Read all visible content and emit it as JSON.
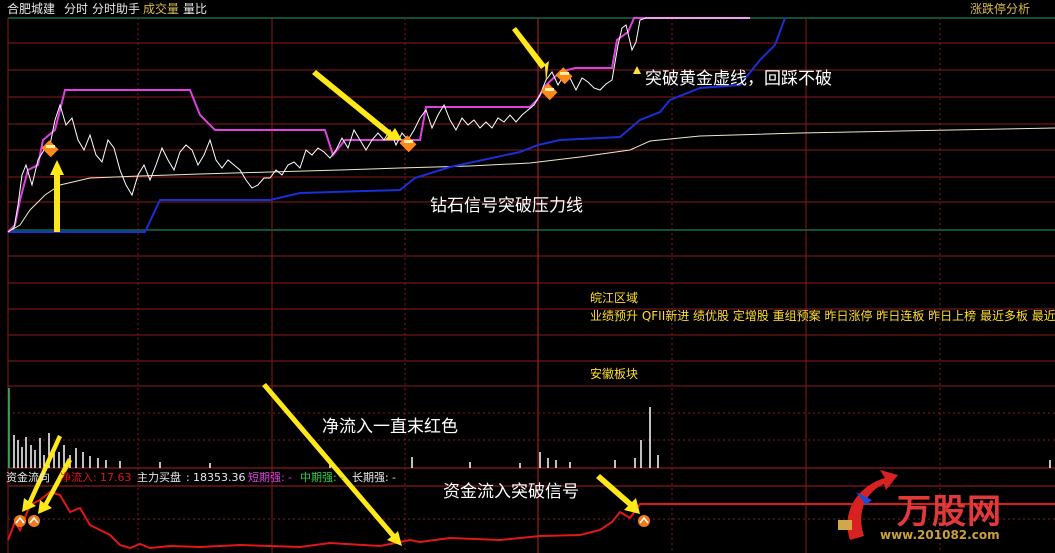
{
  "header": {
    "stock_name": "合肥城建",
    "tab_intraday": "分时",
    "tab_helper": "分时助手",
    "tab_volume": "成交量",
    "tab_ratio": "量比",
    "right_button": "涨跌停分析"
  },
  "annotations": {
    "golden_line": "突破黄金虚线，回踩不破",
    "diamond_signal": "钻石信号突破压力线",
    "net_inflow": "净流入一直末红色",
    "fund_signal": "资金流入突破信号"
  },
  "info_panel": {
    "region": "皖江区域",
    "concepts": "业绩预升 QFII新进 绩优股 定增股 重组预案 昨日涨停 昨日连板 昨日上榜 最近多板 最近异",
    "sector": "安徽板块"
  },
  "fund_bar": {
    "title": "资金流向",
    "net_inflow_label": "净流入",
    "net_inflow_value": "17.63",
    "main_buy_label": "主力买盘",
    "main_buy_value": "18353.36",
    "short_label": "短期强",
    "short_value": "-",
    "mid_label": "中期强",
    "mid_value": "-",
    "long_label": "长期强",
    "long_value": "-"
  },
  "watermark": {
    "logo": "万股网",
    "url": "www.201082.com"
  },
  "colors": {
    "price": "#ffffff",
    "resistance": "#e040e0",
    "support": "#1a2fd8",
    "average": "#f0e6c8",
    "grid": "#8a1c1c",
    "fund": "#e01818"
  }
}
